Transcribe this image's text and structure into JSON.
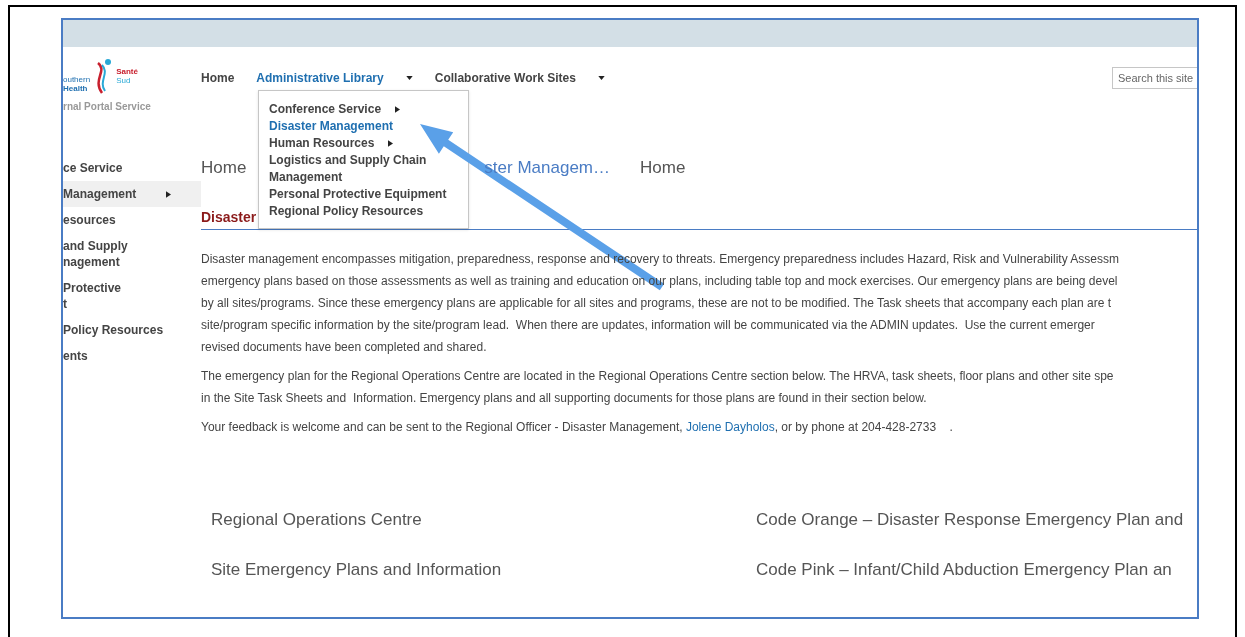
{
  "logo": {
    "name_line1": "Santé",
    "name_line2": "Sud",
    "org_line1": "outhern",
    "org_line2": "Health",
    "subtitle": "rnal Portal Service"
  },
  "top_nav": [
    {
      "label": "Home",
      "selected": false,
      "has_menu": false
    },
    {
      "label": "Administrative Library",
      "selected": true,
      "has_menu": true
    },
    {
      "label": "Collaborative Work Sites",
      "selected": false,
      "has_menu": true
    }
  ],
  "search": {
    "placeholder": "Search this site"
  },
  "dropdown": [
    {
      "label": "Conference Service",
      "selected": false,
      "has_submenu": true
    },
    {
      "label": "Disaster Management",
      "selected": true,
      "has_submenu": false
    },
    {
      "label": "Human Resources",
      "selected": false,
      "has_submenu": true
    },
    {
      "label": "Logistics and Supply Chain Management",
      "selected": false,
      "has_submenu": false
    },
    {
      "label": "Personal Protective Equipment",
      "selected": false,
      "has_submenu": false
    },
    {
      "label": "Regional Policy Resources",
      "selected": false,
      "has_submenu": false
    }
  ],
  "side_nav": [
    {
      "lines": [
        "ce Service"
      ],
      "selected": false,
      "has_submenu": false
    },
    {
      "lines": [
        "Management"
      ],
      "selected": true,
      "has_submenu": true
    },
    {
      "lines": [
        "esources"
      ],
      "selected": false,
      "has_submenu": false
    },
    {
      "lines": [
        "and Supply",
        "nagement"
      ],
      "selected": false,
      "has_submenu": false
    },
    {
      "lines": [
        "Protective",
        "t"
      ],
      "selected": false,
      "has_submenu": false
    },
    {
      "lines": [
        "Policy Resources"
      ],
      "selected": false,
      "has_submenu": false
    },
    {
      "lines": [
        "ents"
      ],
      "selected": false,
      "has_submenu": false
    }
  ],
  "breadcrumb": [
    {
      "label": "Home",
      "kind": "link"
    },
    {
      "label": "ster Managem…",
      "kind": "current"
    },
    {
      "label": "Home",
      "kind": "link"
    }
  ],
  "page_title": "Disaster",
  "paragraphs": [
    {
      "lines": [
        "Disaster management encompasses mitigation, preparedness, response and recovery to threats. Emergency preparedness includes Hazard, Risk and Vulnerability Assessm",
        "emergency plans based on those assessments as well as training and education on our plans, including table top and mock exercises. Our emergency plans are being devel",
        "by all sites/programs. Since these emergency plans are applicable for all sites and programs, these are not to be modified. The Task sheets that accompany each plan are t",
        "site/program specific information by the site/program lead.  When there are updates, information will be communicated via the ADMIN updates.  Use the current emerger",
        "revised documents have been completed and shared."
      ]
    },
    {
      "lines": [
        "The emergency plan for the Regional Operations Centre are located in the Regional Operations Centre section below. The HRVA, task sheets, floor plans and other site spe",
        "in the Site Task Sheets and  Information. Emergency plans and all supporting documents for those plans are found in their section below."
      ]
    }
  ],
  "feedback": {
    "before": "Your feedback is welcome and can be sent to the Regional Officer - Disaster Management, ",
    "link": "Jolene Dayholos",
    "after": ", or by phone at 204-428-2733    ."
  },
  "section_links": [
    [
      "Regional Operations Centre",
      "Code Orange – Disaster Response Emergency Plan and"
    ],
    [
      "Site Emergency Plans and Information",
      "Code Pink – Infant/Child Abduction Emergency Plan an"
    ]
  ]
}
